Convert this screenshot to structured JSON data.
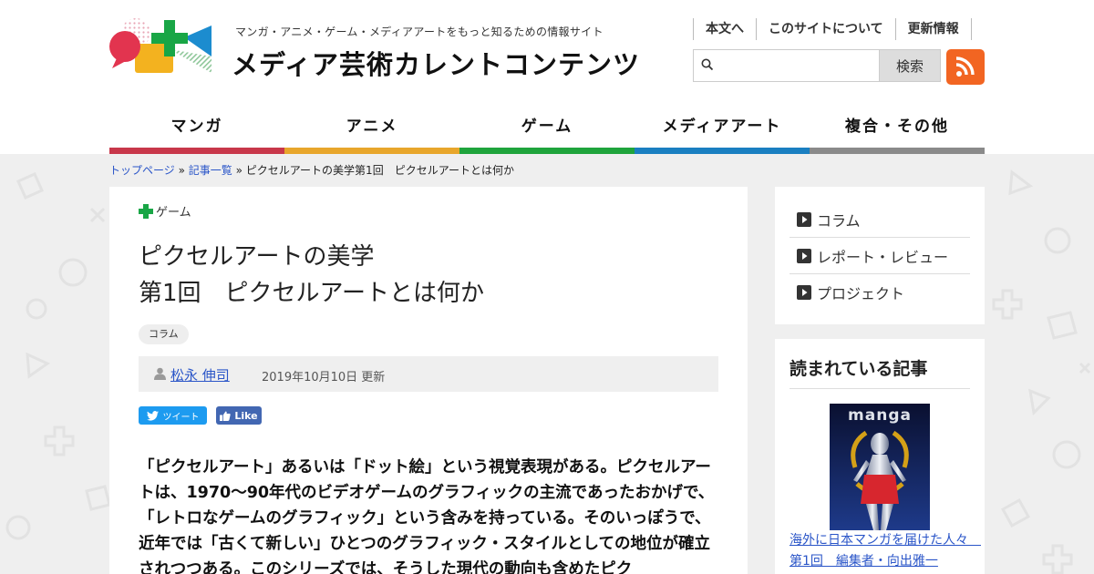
{
  "header": {
    "tagline": "マンガ・アニメ・ゲーム・メディアアートをもっと知るための情報サイト",
    "site_title": "メディア芸術カレントコンテンツ",
    "top_links": [
      "本文へ",
      "このサイトについて",
      "更新情報"
    ],
    "search": {
      "placeholder": "",
      "button_label": "検索"
    }
  },
  "nav": [
    {
      "label": "マンガ",
      "color": "#c8374a"
    },
    {
      "label": "アニメ",
      "color": "#e8a62b"
    },
    {
      "label": "ゲーム",
      "color": "#1fa43c"
    },
    {
      "label": "メディアアート",
      "color": "#1a7fc1"
    },
    {
      "label": "複合・その他",
      "color": "#8a8a8a"
    }
  ],
  "breadcrumb": {
    "home": "トップページ",
    "sep1": "»",
    "list": "記事一覧",
    "sep2": "»",
    "current": "ピクセルアートの美学第1回　ピクセルアートとは何か"
  },
  "article": {
    "category": "ゲーム",
    "title_line1": "ピクセルアートの美学",
    "title_line2": "第1回　ピクセルアートとは何か",
    "tag": "コラム",
    "author": "松永 伸司",
    "date": "2019年10月10日 更新",
    "tweet_label": "ツイート",
    "like_label": "Like",
    "body": "「ピクセルアート」あるいは「ドット絵」という視覚表現がある。ピクセルアートは、1970～90年代のビデオゲームのグラフィックの主流であったおかげで、「レトロなゲームのグラフィック」という含みを持っている。そのいっぽうで、近年では「古くて新しい」ひとつのグラフィック・スタイルとしての地位が確立されつつある。このシリーズでは、そうした現代の動向も含めたピク"
  },
  "sidebar": {
    "categories": [
      "コラム",
      "レポート・レビュー",
      "プロジェクト"
    ],
    "popular_heading": "読まれている記事",
    "popular_thumb_text": "manga",
    "popular_link": "海外に日本マンガを届けた人々　第1回　編集者・向出雅一"
  }
}
